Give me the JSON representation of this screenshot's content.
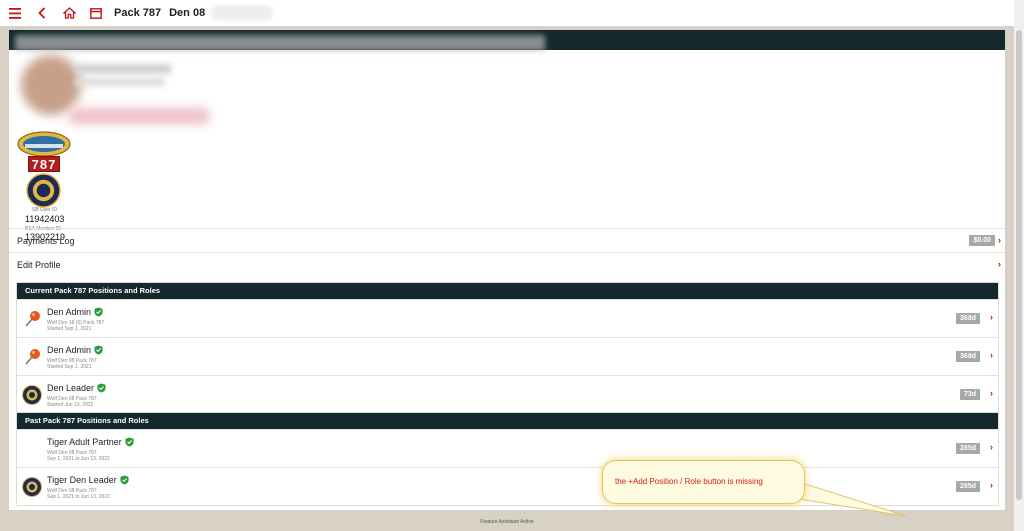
{
  "toolbar": {
    "unit": "Pack 787",
    "den": "Den 08"
  },
  "profile": {
    "unit_number": "787",
    "sb_user_id_label": "SB User ID",
    "sb_user_id": "11942403",
    "bsa_member_id_label": "BSA Member ID",
    "bsa_member_id": "13902219"
  },
  "links": {
    "payments_log": "Payments Log",
    "payments_amount": "$0.00",
    "edit_profile": "Edit Profile"
  },
  "current_section": {
    "title": "Current Pack 787 Positions and Roles",
    "roles": [
      {
        "title": "Den Admin",
        "line1": "Wolf Den 18 (0) Pack 787",
        "line2": "Started Sep 1, 2021",
        "days": "368d",
        "icon": "pin-icon"
      },
      {
        "title": "Den Admin",
        "line1": "Wolf Den 08 Pack 787",
        "line2": "Started Sep 1, 2021",
        "days": "368d",
        "icon": "pin-icon"
      },
      {
        "title": "Den Leader",
        "line1": "Wolf Den 08 Pack 787",
        "line2": "Started Jun 13, 2022",
        "days": "73d",
        "icon": "cub-scout-badge-icon"
      }
    ]
  },
  "past_section": {
    "title": "Past Pack 787 Positions and Roles",
    "roles": [
      {
        "title": "Tiger Adult Partner",
        "line1": "Wolf Den 08 Pack 787",
        "line2": "Sep 1, 2021 to Jun 13, 2022",
        "days": "285d",
        "icon": ""
      },
      {
        "title": "Tiger Den Leader",
        "line1": "Wolf Den 08 Pack 787",
        "line2": "Sep 1, 2021 to Jun 13, 2022",
        "days": "285d",
        "icon": "cub-scout-badge-icon"
      }
    ]
  },
  "callout": {
    "text": "the +Add Position / Role button is missing"
  },
  "footer": {
    "text": "Feature Assistant Active"
  },
  "colors": {
    "accent_red": "#b31414",
    "header_dark": "#14282e",
    "check_green": "#2e9b3a"
  }
}
